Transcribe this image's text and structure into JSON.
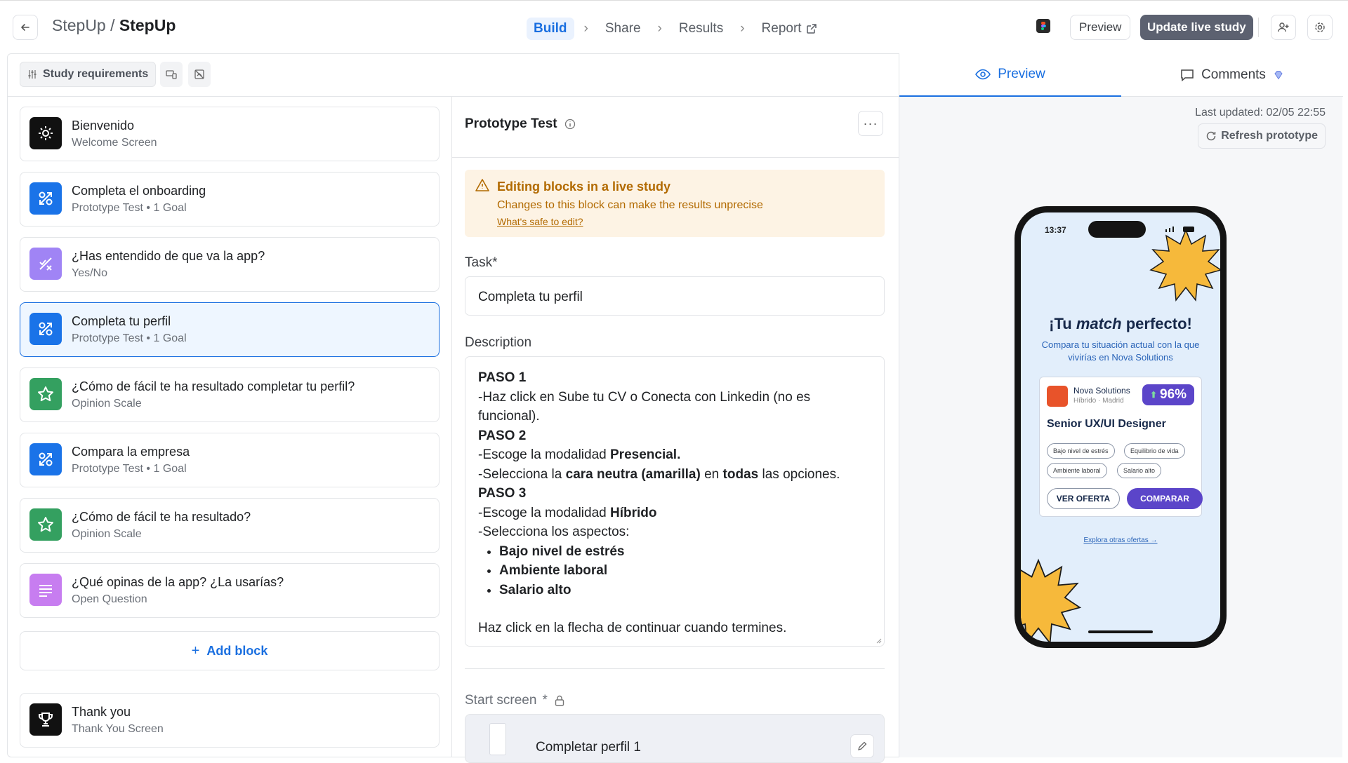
{
  "header": {
    "breadcrumb_prefix": "StepUp /",
    "breadcrumb_current": "StepUp",
    "steps": [
      {
        "label": "Build",
        "active": true
      },
      {
        "label": "Share",
        "active": false
      },
      {
        "label": "Results",
        "active": false
      },
      {
        "label": "Report",
        "active": false
      }
    ],
    "preview_label": "Preview",
    "update_label": "Update live study"
  },
  "toolbar": {
    "study_requirements_label": "Study requirements"
  },
  "blocks": [
    {
      "title": "Bienvenido",
      "subtitle": "Welcome Screen",
      "icon": "sun-icon",
      "color": "#111111",
      "selected": false
    },
    {
      "title": "Completa el onboarding",
      "subtitle": "Prototype Test • 1 Goal",
      "icon": "prototype-icon",
      "color": "#1a73e8",
      "selected": false
    },
    {
      "title": "¿Has entendido de que va la app?",
      "subtitle": "Yes/No",
      "icon": "yes-no-icon",
      "color": "#a084f5",
      "selected": false
    },
    {
      "title": "Completa tu perfil",
      "subtitle": "Prototype Test • 1 Goal",
      "icon": "prototype-icon",
      "color": "#1a73e8",
      "selected": true
    },
    {
      "title": "¿Cómo de fácil te ha resultado completar tu perfil?",
      "subtitle": "Opinion Scale",
      "icon": "star-icon",
      "color": "#34a060",
      "selected": false
    },
    {
      "title": "Compara la empresa",
      "subtitle": "Prototype Test • 1 Goal",
      "icon": "prototype-icon",
      "color": "#1a73e8",
      "selected": false
    },
    {
      "title": "¿Cómo de fácil te ha resultado?",
      "subtitle": "Opinion Scale",
      "icon": "star-icon",
      "color": "#34a060",
      "selected": false
    },
    {
      "title": "¿Qué opinas de la app? ¿La usarías?",
      "subtitle": "Open Question",
      "icon": "text-lines-icon",
      "color": "#c77df0",
      "selected": false
    }
  ],
  "add_block_label": "Add block",
  "thank_you": {
    "title": "Thank you",
    "subtitle": "Thank You Screen",
    "icon": "trophy-icon"
  },
  "editor": {
    "title": "Prototype Test",
    "more_label": "···",
    "warning": {
      "title": "Editing blocks in a live study",
      "text": "Changes to this block can make the results unprecise",
      "link": "What's safe to edit?"
    },
    "task_label": "Task*",
    "task_value": "Completa tu perfil",
    "description_label": "Description",
    "description": {
      "paso1": "PASO 1",
      "line1": "-Haz click en Sube tu CV o Conecta con Linkedin (no es funcional).",
      "paso2": "PASO 2",
      "line2a": "-Escoge la modalidad ",
      "line2a_bold": "Presencial.",
      "line2b_1": "-Selecciona la ",
      "line2b_bold1": "cara neutra (amarilla)",
      "line2b_2": " en ",
      "line2b_bold2": "todas",
      "line2b_3": " las opciones.",
      "paso3": "PASO 3",
      "line3a": "-Escoge la modalidad ",
      "line3a_bold": "Híbrido",
      "line3b": "-Selecciona los aspectos:",
      "bullets": [
        "Bajo nivel de estrés",
        "Ambiente laboral",
        "Salario alto"
      ],
      "closing": "Haz click en la flecha de continuar cuando termines."
    },
    "start_screen_label": "Start screen",
    "start_screen_required": "*",
    "start_screen_value": "Completar perfil 1"
  },
  "preview_panel": {
    "tab_preview": "Preview",
    "tab_comments": "Comments",
    "last_updated": "Last updated: 02/05 22:55",
    "refresh_label": "Refresh prototype",
    "phone": {
      "time": "13:37",
      "title_prefix": "¡Tu ",
      "title_em": "match",
      "title_suffix": " perfecto!",
      "subtitle": "Compara tu situación actual con la que vivirías en Nova Solutions",
      "company": "Nova Solutions",
      "location": "Híbrido · Madrid",
      "match_pct": "96%",
      "role": "Senior UX/UI Designer",
      "chips": [
        "Bajo nivel de estrés",
        "Equilibrio de vida",
        "Ambiente laboral",
        "Salario alto"
      ],
      "btn_offer": "VER OFERTA",
      "btn_compare": "COMPARAR",
      "link": "Explora otras ofertas →"
    }
  },
  "colors": {
    "accent": "#1a6fe0",
    "update_button": "#5c6170",
    "warning_bg": "#fdf3e4",
    "warning_text": "#b26a00",
    "phone_accent": "#5b45c9",
    "starburst": "#f6b93b"
  }
}
